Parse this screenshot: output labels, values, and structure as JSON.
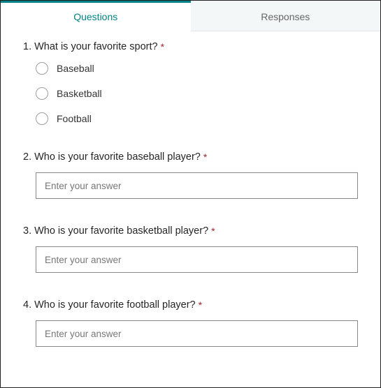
{
  "tabs": {
    "questions": "Questions",
    "responses": "Responses"
  },
  "questions": [
    {
      "num": "1.",
      "text": "What is your favorite sport?",
      "required": "*",
      "type": "choice",
      "options": [
        "Baseball",
        "Basketball",
        "Football"
      ]
    },
    {
      "num": "2.",
      "text": "Who is your favorite baseball player?",
      "required": "*",
      "type": "text",
      "placeholder": "Enter your answer"
    },
    {
      "num": "3.",
      "text": "Who is your favorite basketball player?",
      "required": "*",
      "type": "text",
      "placeholder": "Enter your answer"
    },
    {
      "num": "4.",
      "text": "Who is your favorite football player?",
      "required": "*",
      "type": "text",
      "placeholder": "Enter your answer"
    }
  ]
}
